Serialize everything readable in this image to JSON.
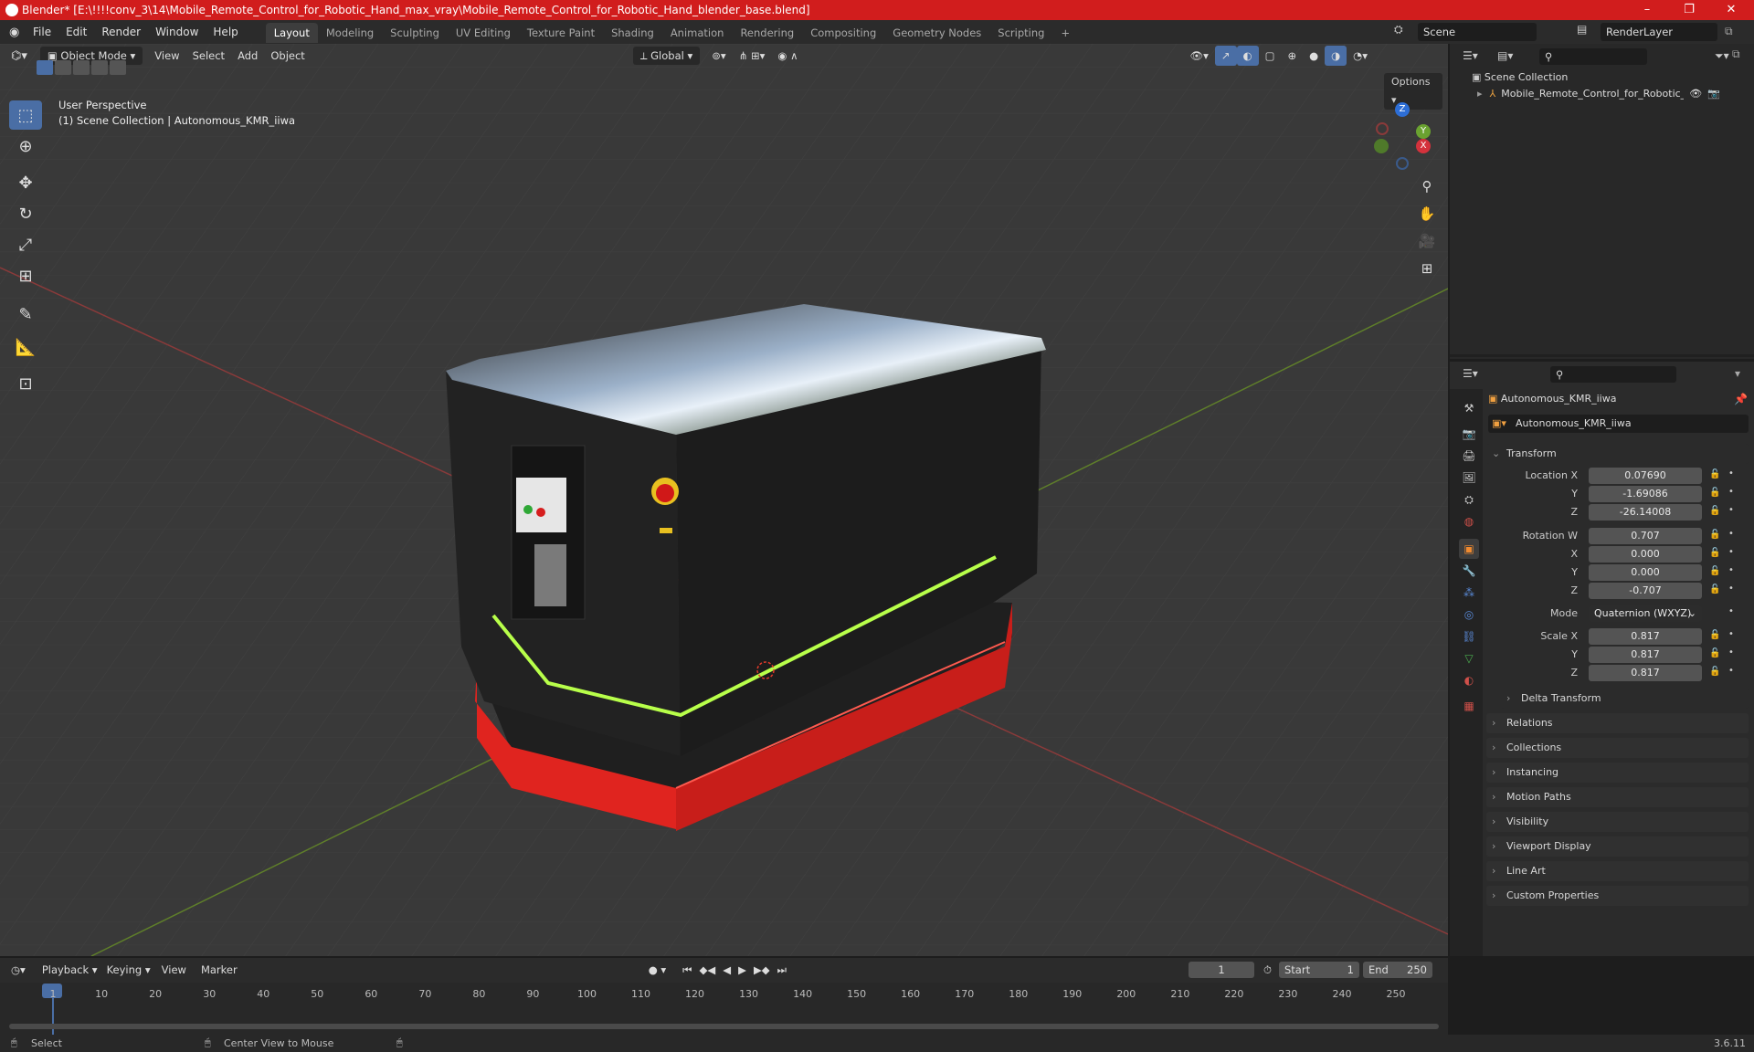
{
  "window": {
    "title": "Blender* [E:\\!!!!conv_3\\14\\Mobile_Remote_Control_for_Robotic_Hand_max_vray\\Mobile_Remote_Control_for_Robotic_Hand_blender_base.blend]",
    "controls": [
      "–",
      "❐",
      "✕"
    ]
  },
  "menu": [
    "File",
    "Edit",
    "Render",
    "Window",
    "Help"
  ],
  "workspaces": [
    "Layout",
    "Modeling",
    "Sculpting",
    "UV Editing",
    "Texture Paint",
    "Shading",
    "Animation",
    "Rendering",
    "Compositing",
    "Geometry Nodes",
    "Scripting",
    "+"
  ],
  "scene": {
    "label": "Scene",
    "render_layer": "RenderLayer"
  },
  "viewport": {
    "mode": "Object Mode",
    "menus": [
      "View",
      "Select",
      "Add",
      "Object"
    ],
    "orientation": "Global",
    "options": "Options",
    "overlay_line1": "User Perspective",
    "overlay_line2": "(1) Scene Collection | Autonomous_KMR_iiwa",
    "gizmo_axes": [
      "Z",
      "Y",
      "X"
    ]
  },
  "outliner": {
    "root": "Scene Collection",
    "item": "Mobile_Remote_Control_for_Robotic_Ha"
  },
  "properties": {
    "object_name": "Autonomous_KMR_iiwa",
    "datablock": "Autonomous_KMR_iiwa",
    "transform_title": "Transform",
    "location": {
      "label_x": "Location X",
      "x": "0.07690",
      "y": "-1.69086",
      "z": "-26.14008"
    },
    "rotation": {
      "label_w": "Rotation W",
      "w": "0.707",
      "x": "0.000",
      "y": "0.000",
      "z": "-0.707"
    },
    "mode_label": "Mode",
    "mode_value": "Quaternion (WXYZ)",
    "scale": {
      "label_x": "Scale X",
      "x": "0.817",
      "y": "0.817",
      "z": "0.817"
    },
    "axis_labels": {
      "y": "Y",
      "z": "Z",
      "x": "X"
    },
    "delta": "Delta Transform",
    "panels": [
      "Relations",
      "Collections",
      "Instancing",
      "Motion Paths",
      "Visibility",
      "Viewport Display",
      "Line Art",
      "Custom Properties"
    ]
  },
  "timeline": {
    "menus": [
      "Playback",
      "Keying",
      "View",
      "Marker"
    ],
    "current_frame": "1",
    "start_label": "Start",
    "start": "1",
    "end_label": "End",
    "end": "250",
    "ticks": [
      "1",
      "10",
      "20",
      "30",
      "40",
      "50",
      "60",
      "70",
      "80",
      "90",
      "100",
      "110",
      "120",
      "130",
      "140",
      "150",
      "160",
      "170",
      "180",
      "190",
      "200",
      "210",
      "220",
      "230",
      "240",
      "250"
    ]
  },
  "status": {
    "left": "Select",
    "middle": "Center View to Mouse",
    "version": "3.6.11"
  },
  "colors": {
    "titlebar": "#d11d1d",
    "accent": "#4a6ea5",
    "robot_red": "#e0241f",
    "neon": "#b8ff4a"
  }
}
